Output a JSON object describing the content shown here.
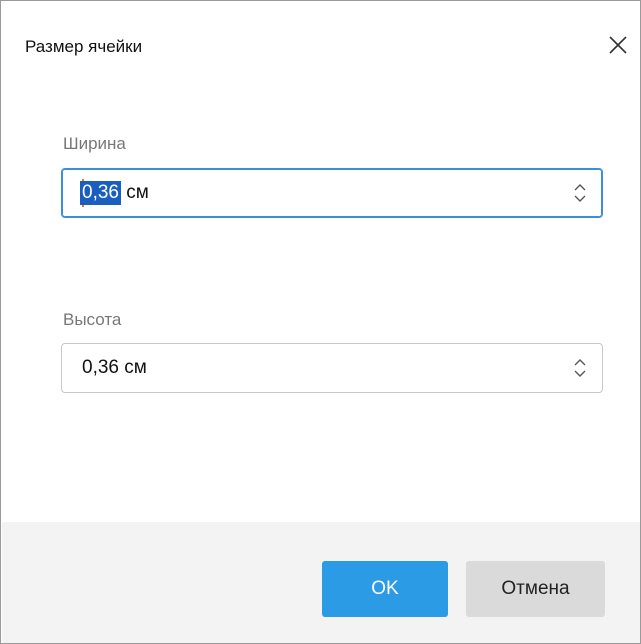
{
  "dialog": {
    "title": "Размер ячейки",
    "close_icon": "close-icon"
  },
  "width_field": {
    "label": "Ширина",
    "value_selected": "0,36",
    "unit": " см"
  },
  "height_field": {
    "label": "Высота",
    "value": "0,36 см"
  },
  "buttons": {
    "ok_label": "OK",
    "cancel_label": "Отмена"
  },
  "colors": {
    "accent": "#2b9be6",
    "focus_border": "#3b8fd9",
    "selection": "#1a5fbf",
    "footer_bg": "#f3f3f3"
  }
}
